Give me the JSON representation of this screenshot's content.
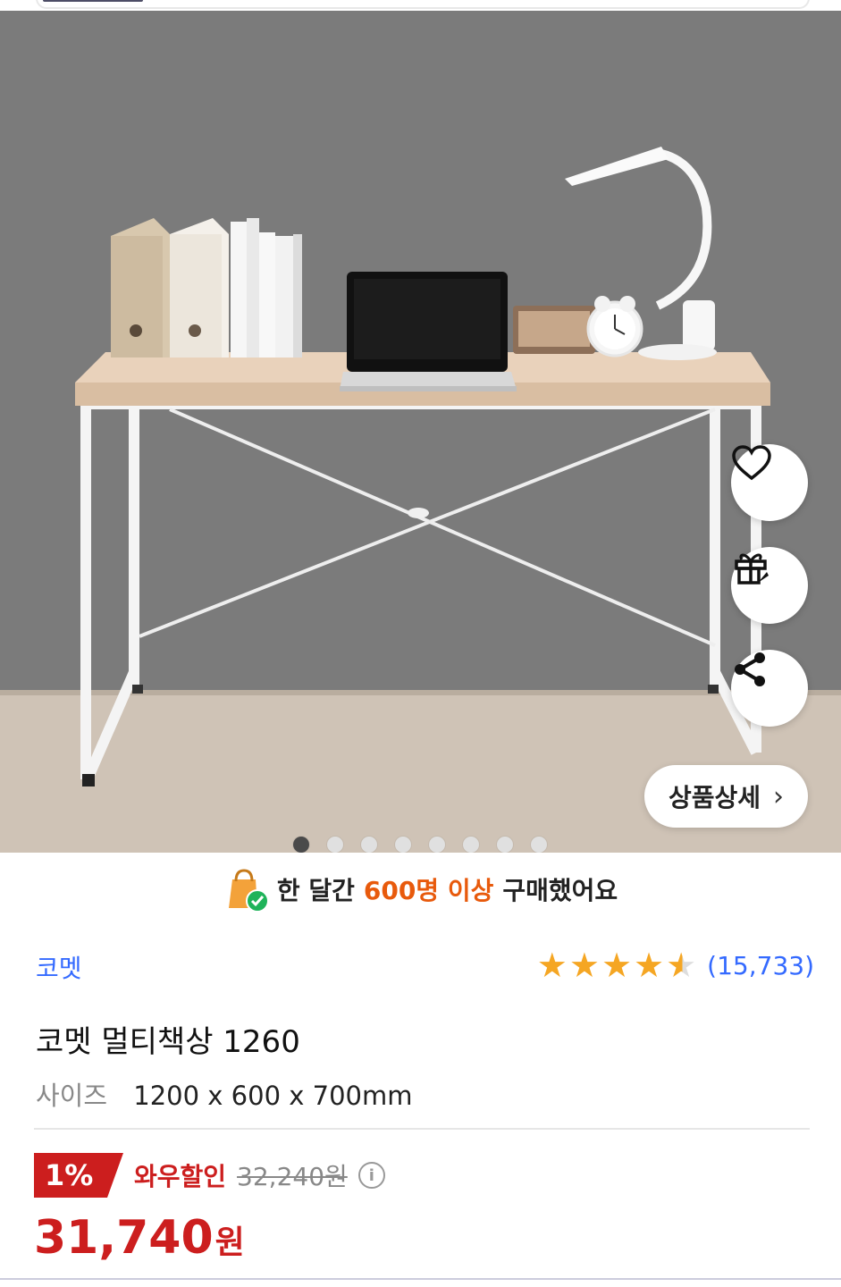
{
  "gallery": {
    "total_images": 8,
    "active_index": 0,
    "detail_button_label": "상품상세"
  },
  "social_proof": {
    "prefix": "한 달간",
    "highlight": "600명 이상",
    "suffix": "구매했어요"
  },
  "product": {
    "brand": "코멧",
    "rating_value": 4.5,
    "review_count": "(15,733)",
    "title": "코멧 멀티책상 1260",
    "size_label": "사이즈",
    "size_value": "1200 x 600 x 700mm"
  },
  "pricing": {
    "discount_badge": "1%",
    "discount_label": "와우할인",
    "original_price": "32,240원",
    "info_icon": "i",
    "sale_price": "31,740",
    "currency": "원"
  },
  "colors": {
    "accent_blue": "#346aff",
    "sale_red": "#cc1e1e",
    "highlight_orange": "#e85a0c",
    "star_gold": "#f5a623"
  }
}
